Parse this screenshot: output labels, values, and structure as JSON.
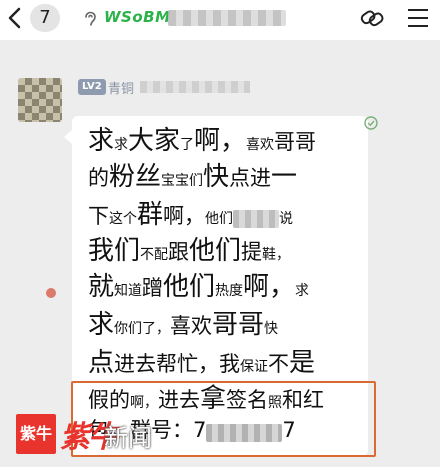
{
  "header": {
    "unread_count": "7",
    "group_tag": "WSoBM"
  },
  "sender": {
    "level": "LV2",
    "level_name": "青铜"
  },
  "message": {
    "lines": [
      [
        {
          "t": "求",
          "s": "lg"
        },
        {
          "t": "求",
          "s": "sm"
        },
        {
          "t": "大家",
          "s": "lg"
        },
        {
          "t": "了",
          "s": "sm"
        },
        {
          "t": "啊，",
          "s": "lg"
        },
        {
          "t": "喜欢",
          "s": "sm"
        },
        {
          "t": "哥哥",
          "s": "md"
        }
      ],
      [
        {
          "t": "的",
          "s": "md"
        },
        {
          "t": "粉丝",
          "s": "lg"
        },
        {
          "t": "宝宝们",
          "s": "sm"
        },
        {
          "t": "快",
          "s": "lg"
        },
        {
          "t": "点进",
          "s": "md"
        },
        {
          "t": "一",
          "s": "lg"
        }
      ],
      [
        {
          "t": "下",
          "s": "md"
        },
        {
          "t": "这个",
          "s": "sm"
        },
        {
          "t": "群",
          "s": "lg"
        },
        {
          "t": "啊，",
          "s": "md"
        },
        {
          "t": "他们",
          "s": "sm"
        },
        {
          "t": "",
          "s": "blur"
        },
        {
          "t": "说",
          "s": "sm"
        }
      ],
      [
        {
          "t": "我们",
          "s": "lg"
        },
        {
          "t": "不配",
          "s": "sm"
        },
        {
          "t": "跟",
          "s": "md"
        },
        {
          "t": "他们",
          "s": "lg"
        },
        {
          "t": "提",
          "s": "md"
        },
        {
          "t": "鞋，",
          "s": "sm"
        }
      ],
      [
        {
          "t": "就",
          "s": "lg"
        },
        {
          "t": "知道",
          "s": "sm"
        },
        {
          "t": "蹭",
          "s": "md"
        },
        {
          "t": "他们",
          "s": "lg"
        },
        {
          "t": "热度",
          "s": "sm"
        },
        {
          "t": "啊，",
          "s": "lg"
        },
        {
          "t": "求",
          "s": "sm"
        }
      ],
      [
        {
          "t": "求",
          "s": "lg"
        },
        {
          "t": "你们了，",
          "s": "sm"
        },
        {
          "t": "喜欢",
          "s": "md"
        },
        {
          "t": "哥哥",
          "s": "lg"
        },
        {
          "t": "快",
          "s": "sm"
        }
      ],
      [
        {
          "t": "点",
          "s": "lg"
        },
        {
          "t": "进去帮忙，",
          "s": "md"
        },
        {
          "t": "我",
          "s": "md"
        },
        {
          "t": "保证",
          "s": "sm"
        },
        {
          "t": "不",
          "s": "md"
        },
        {
          "t": "是",
          "s": "lg"
        }
      ],
      [
        {
          "t": "假的",
          "s": "md"
        },
        {
          "t": "啊，",
          "s": "sm"
        },
        {
          "t": "进去",
          "s": "md"
        },
        {
          "t": "拿",
          "s": "lg"
        },
        {
          "t": "签名",
          "s": "md"
        },
        {
          "t": "照",
          "s": "sm"
        },
        {
          "t": "和红",
          "s": "md"
        }
      ],
      [
        {
          "t": "包。群号：7",
          "s": "md"
        },
        {
          "t": "",
          "s": "blurnum"
        },
        {
          "t": "7",
          "s": "md"
        }
      ]
    ]
  },
  "watermark": {
    "logo": "紫牛",
    "brand": "紫牛",
    "news": "新闻"
  },
  "colors": {
    "accent": "#e8342c",
    "highlight_border": "#d96a32",
    "green_tag": "#2bb34a"
  }
}
